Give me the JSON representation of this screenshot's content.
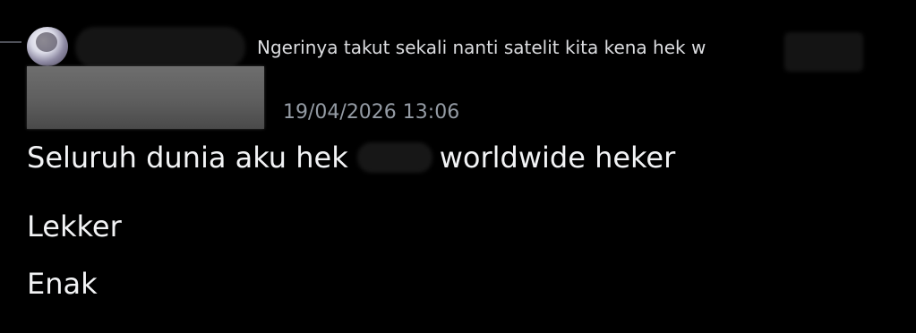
{
  "reply": {
    "avatar_icon": "user-avatar-icon",
    "text": "Ngerinya takut sekali nanti satelit kita kena hek w"
  },
  "message": {
    "timestamp": "19/04/2026 13:06",
    "lines": [
      {
        "before": "Seluruh dunia aku hek",
        "after": "worldwide heker"
      },
      {
        "text": "Lekker"
      },
      {
        "text": "Enak"
      }
    ]
  }
}
